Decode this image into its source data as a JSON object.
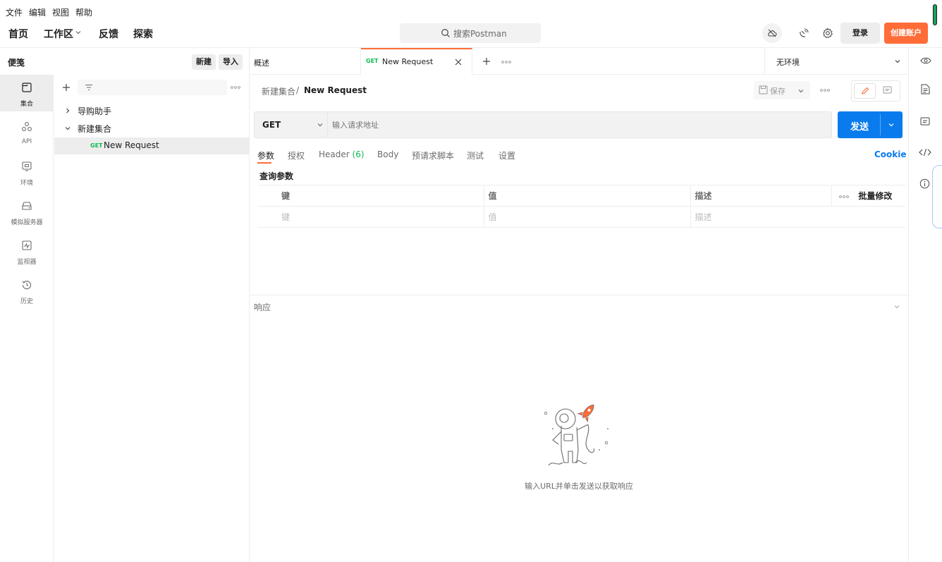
{
  "menubar": {
    "file": "文件",
    "edit": "编辑",
    "view": "视图",
    "help": "帮助"
  },
  "header": {
    "nav_home": "首页",
    "nav_workspace": "工作区",
    "nav_feedback": "反馈",
    "nav_explore": "探索",
    "search_placeholder": "搜索Postman",
    "signin": "登录",
    "create_account": "创建账户"
  },
  "sidebar": {
    "title": "便笺",
    "new_label": "新建",
    "import_label": "导入",
    "rail": [
      {
        "label": "集合",
        "icon": "collection-icon"
      },
      {
        "label": "API",
        "icon": "api-icon"
      },
      {
        "label": "环境",
        "icon": "environment-icon"
      },
      {
        "label": "模拟服务器",
        "icon": "mock-server-icon"
      },
      {
        "label": "监视器",
        "icon": "monitor-icon"
      },
      {
        "label": "历史",
        "icon": "history-icon"
      }
    ],
    "tree": {
      "item1": "导购助手",
      "item2": "新建集合",
      "request_method": "GET",
      "request_name": "New Request"
    }
  },
  "tabs": {
    "overview": "概述",
    "active_method": "GET",
    "active_name": "New Request",
    "environment": "无环境"
  },
  "request": {
    "breadcrumb_collection": "新建集合",
    "breadcrumb_sep": "/",
    "breadcrumb_request": "New Request",
    "save_label": "保存",
    "method": "GET",
    "url_placeholder": "输入请求地址",
    "send_label": "发送",
    "tabs": {
      "params": "参数",
      "auth": "授权",
      "headers": "Header",
      "headers_count": "(6)",
      "body": "Body",
      "prerequest": "预请求脚本",
      "tests": "测试",
      "settings": "设置"
    },
    "cookie_label": "Cookie",
    "query_params_title": "查询参数",
    "table": {
      "col_key": "键",
      "col_value": "值",
      "col_desc": "描述",
      "bulk_edit": "批量修改",
      "ph_key": "键",
      "ph_value": "值",
      "ph_desc": "描述"
    }
  },
  "response": {
    "title": "响应",
    "empty_hint": "输入URL并单击发送以获取响应"
  },
  "colors": {
    "accent_orange": "#ff6c37",
    "send_blue": "#097bed",
    "get_green": "#0cbb52",
    "cookie_blue": "#097bed"
  }
}
